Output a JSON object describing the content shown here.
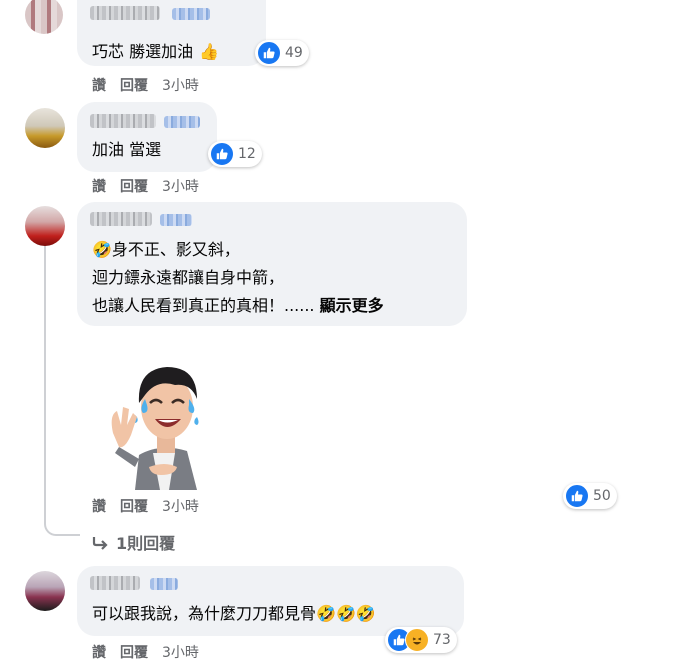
{
  "comments": [
    {
      "text": "巧芯 勝選加油",
      "text_emoji": "👍",
      "like_count": "49",
      "actions": {
        "like": "讚",
        "reply": "回覆",
        "time": "3小時"
      }
    },
    {
      "text": "加油 當選",
      "like_count": "12",
      "actions": {
        "like": "讚",
        "reply": "回覆",
        "time": "3小時"
      }
    },
    {
      "lead_emoji": "🤣",
      "line1": "身不正、影又斜，",
      "line2": "迴力鏢永遠都讓自身中箭，",
      "line3": "也讓人民看到真正的真相！......",
      "see_more": "顯示更多",
      "like_count": "50",
      "actions": {
        "like": "讚",
        "reply": "回覆",
        "time": "3小時"
      },
      "replies_link": "1則回覆"
    },
    {
      "text": "可以跟我說，為什麼刀刀都見骨",
      "text_emoji": "🤣🤣🤣",
      "like_count": "73",
      "actions": {
        "like": "讚",
        "reply": "回覆",
        "time": "3小時"
      }
    }
  ],
  "icons": {
    "like": "thumbs-up-icon",
    "haha": "laughing-face-icon",
    "reply_arrow": "reply-arrow-icon",
    "sticker": "laughing-avatar-sticker"
  },
  "colors": {
    "bubble": "#f0f2f5",
    "like_blue": "#1877f2",
    "meta_gray": "#65676b"
  }
}
